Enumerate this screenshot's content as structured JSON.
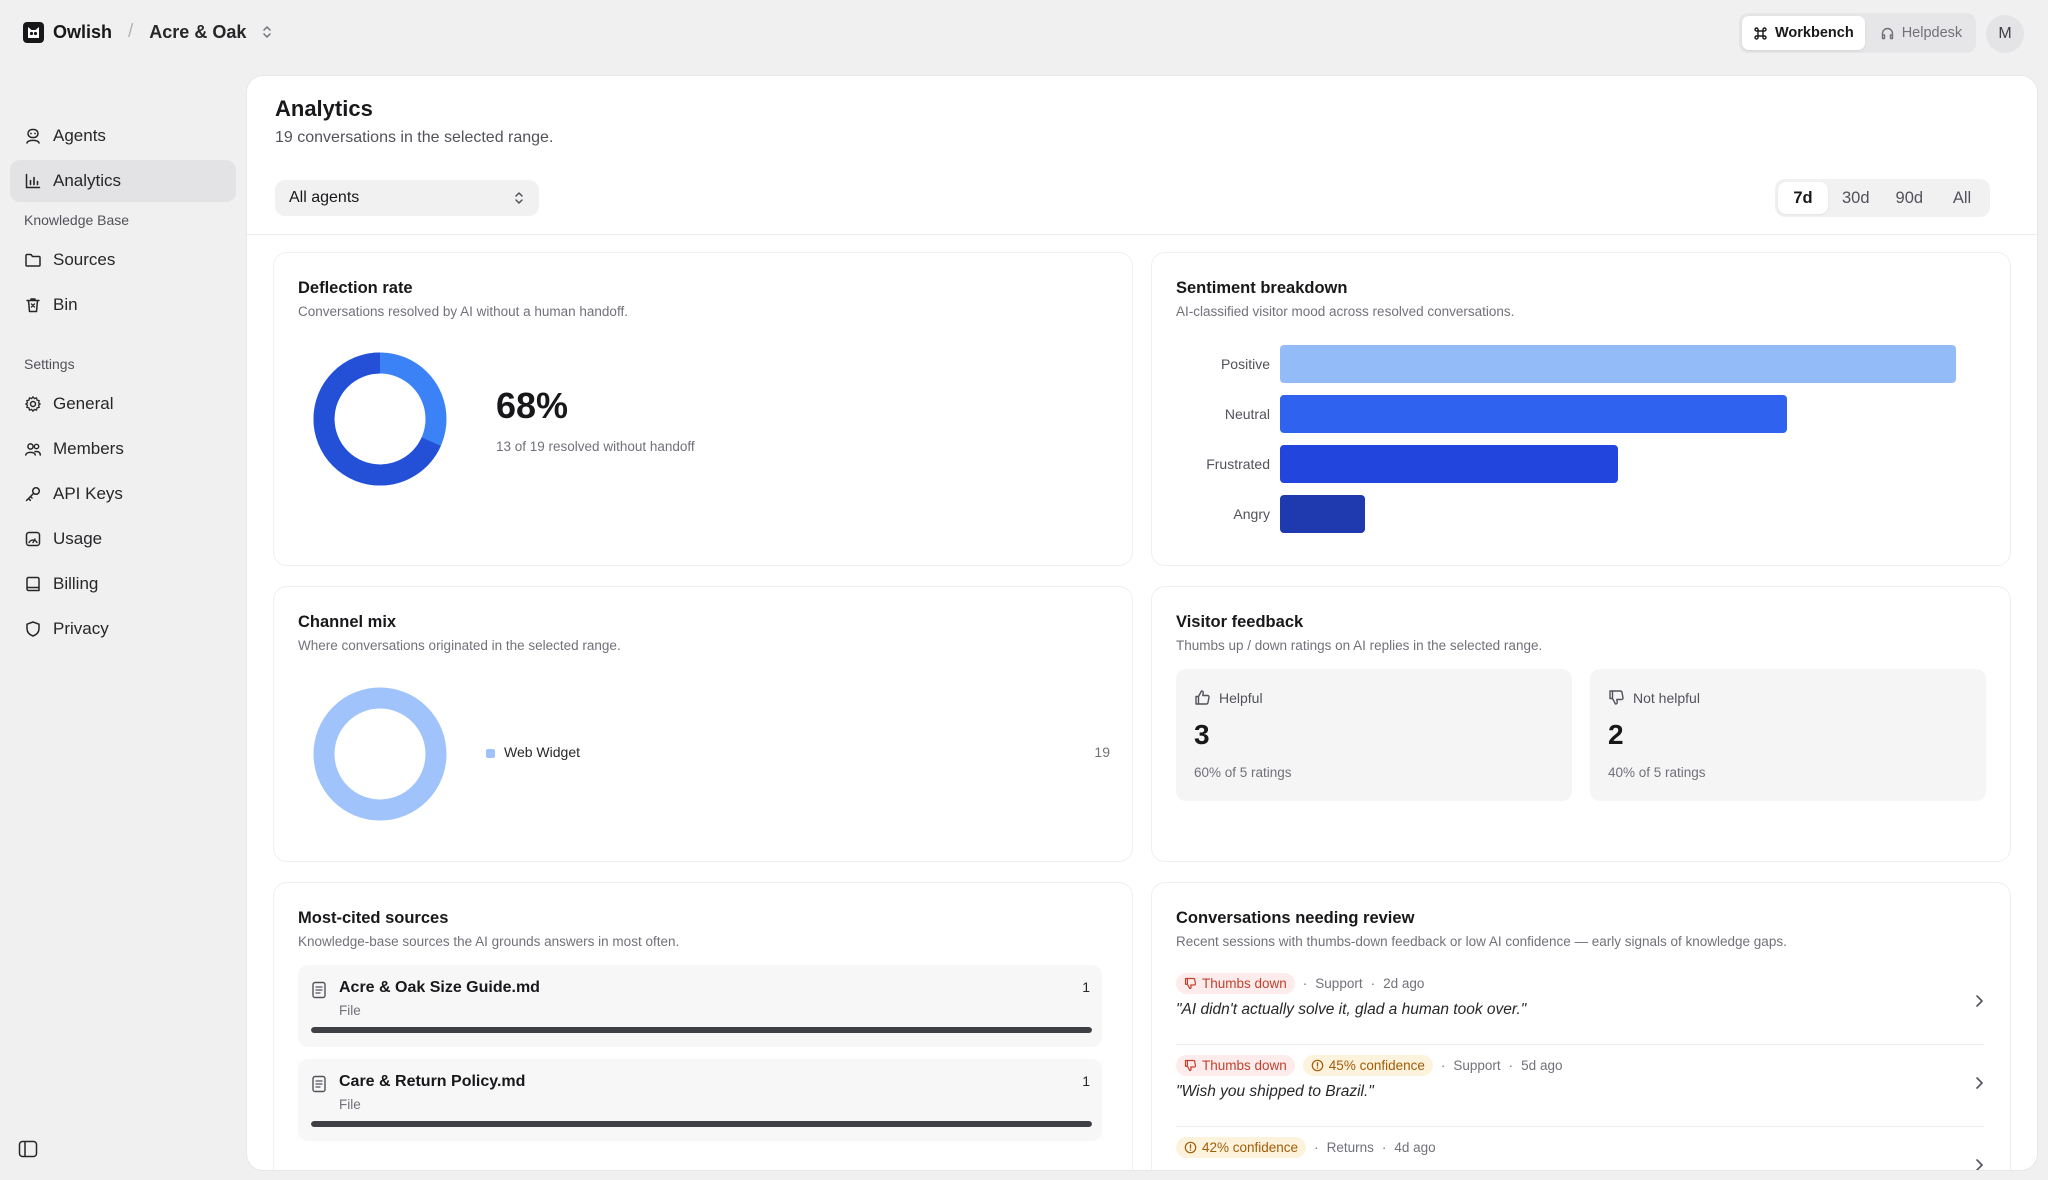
{
  "header": {
    "brand": "Owlish",
    "separator": "/",
    "workspace": "Acre & Oak",
    "modes": [
      {
        "label": "Workbench",
        "active": true
      },
      {
        "label": "Helpdesk",
        "active": false
      }
    ],
    "avatar_initial": "M"
  },
  "sidebar": {
    "main_items": [
      {
        "label": "Agents",
        "icon": "agents-icon"
      },
      {
        "label": "Analytics",
        "icon": "analytics-icon",
        "active": true
      }
    ],
    "knowledge_title": "Knowledge Base",
    "knowledge_items": [
      {
        "label": "Sources",
        "icon": "folder-icon"
      },
      {
        "label": "Bin",
        "icon": "bin-icon"
      }
    ],
    "settings_title": "Settings",
    "settings_items": [
      {
        "label": "General",
        "icon": "gear-icon"
      },
      {
        "label": "Members",
        "icon": "members-icon"
      },
      {
        "label": "API Keys",
        "icon": "key-icon"
      },
      {
        "label": "Usage",
        "icon": "usage-icon"
      },
      {
        "label": "Billing",
        "icon": "billing-icon"
      },
      {
        "label": "Privacy",
        "icon": "shield-icon"
      }
    ]
  },
  "page": {
    "title": "Analytics",
    "subtitle": "19 conversations in the selected range.",
    "agent_filter": "All agents",
    "ranges": [
      "7d",
      "30d",
      "90d",
      "All"
    ],
    "active_range": "7d"
  },
  "deflection": {
    "title": "Deflection rate",
    "subtitle": "Conversations resolved by AI without a human handoff.",
    "value": "68%",
    "note": "13 of 19 resolved without handoff",
    "resolved": 13,
    "total": 19,
    "colors": {
      "resolved": "#2450d8",
      "handoff": "#3b82f6"
    }
  },
  "sentiment": {
    "title": "Sentiment breakdown",
    "subtitle": "AI-classified visitor mood across resolved conversations.",
    "chart_data": {
      "type": "bar",
      "orientation": "horizontal",
      "categories": [
        "Positive",
        "Neutral",
        "Frustrated",
        "Angry"
      ],
      "values": [
        8,
        6,
        4,
        1
      ],
      "colors": [
        "#93bbf7",
        "#2f63ef",
        "#2145dd",
        "#1e3aae"
      ]
    }
  },
  "channel": {
    "title": "Channel mix",
    "subtitle": "Where conversations originated in the selected range.",
    "chart_data": {
      "type": "pie",
      "categories": [
        "Web Widget"
      ],
      "values": [
        19
      ],
      "colors": [
        "#9fc3fa"
      ]
    },
    "legend": [
      {
        "label": "Web Widget",
        "count": "19",
        "color": "#9fc3fa"
      }
    ]
  },
  "feedback": {
    "title": "Visitor feedback",
    "subtitle": "Thumbs up / down ratings on AI replies in the selected range.",
    "helpful": {
      "label": "Helpful",
      "value": "3",
      "note": "60% of 5 ratings"
    },
    "not_helpful": {
      "label": "Not helpful",
      "value": "2",
      "note": "40% of 5 ratings"
    }
  },
  "sources": {
    "title": "Most-cited sources",
    "subtitle": "Knowledge-base sources the AI grounds answers in most often.",
    "items": [
      {
        "name": "Acre & Oak Size Guide.md",
        "type": "File",
        "count": "1",
        "share": 1.0
      },
      {
        "name": "Care & Return Policy.md",
        "type": "File",
        "count": "1",
        "share": 1.0
      }
    ]
  },
  "review": {
    "title": "Conversations needing review",
    "subtitle": "Recent sessions with thumbs-down feedback or low AI confidence — early signals of knowledge gaps.",
    "items": [
      {
        "thumbs": "Thumbs down",
        "confidence": "",
        "category": "Support",
        "time": "2d ago",
        "quote": "\"AI didn't actually solve it, glad a human took over.\""
      },
      {
        "thumbs": "Thumbs down",
        "confidence": "45% confidence",
        "category": "Support",
        "time": "5d ago",
        "quote": "\"Wish you shipped to Brazil.\""
      },
      {
        "thumbs": "",
        "confidence": "42% confidence",
        "category": "Returns",
        "time": "4d ago",
        "quote": ""
      }
    ]
  }
}
